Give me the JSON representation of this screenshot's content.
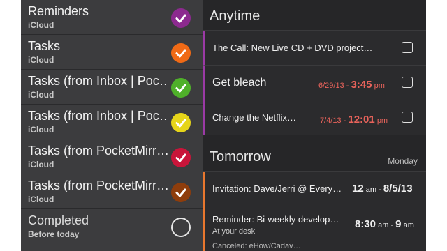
{
  "lists": [
    {
      "name": "Reminders",
      "account": "iCloud",
      "color": "#8c2a8f",
      "checked": true
    },
    {
      "name": "Tasks",
      "account": "iCloud",
      "color": "#f06a16",
      "checked": true
    },
    {
      "name": "Tasks (from Inbox | Poc…",
      "account": "iCloud",
      "color": "#4fb02a",
      "checked": true
    },
    {
      "name": "Tasks (from Inbox | Poc…",
      "account": "iCloud",
      "color": "#e6d51a",
      "checked": true
    },
    {
      "name": "Tasks (from PocketMirr…",
      "account": "iCloud",
      "color": "#c8153a",
      "checked": true
    },
    {
      "name": "Tasks (from PocketMirr…",
      "account": "iCloud",
      "color": "#8e3d0c",
      "checked": true
    },
    {
      "name": "Completed",
      "account": "Before today",
      "color": "#e6e6e6",
      "checked": false
    }
  ],
  "anytime": {
    "title": "Anytime",
    "tasks": [
      {
        "title": "The Call: New Live CD + DVD project…",
        "date": "",
        "time": "",
        "ampm": ""
      },
      {
        "title": "Get bleach",
        "date": "6/29/13 -",
        "time": "3:45",
        "ampm": "pm"
      },
      {
        "title": "Change the Netflix…",
        "date": "7/4/13 -",
        "time": "12:01",
        "ampm": "pm"
      }
    ]
  },
  "tomorrow": {
    "title": "Tomorrow",
    "day": "Monday",
    "tasks": [
      {
        "title": "Invitation: Dave/Jerri @ Every…",
        "start": "12",
        "start_ampm": "am",
        "dash": "-",
        "end": "8/5/13",
        "sub": ""
      },
      {
        "title": "Reminder: Bi-weekly develop…",
        "start": "8:30",
        "start_ampm": "am",
        "dash": "-",
        "end": "9",
        "end_ampm": "am",
        "sub": "At your desk"
      },
      {
        "title": "Canceled: eHow/Cadav…",
        "sub": ""
      }
    ]
  }
}
